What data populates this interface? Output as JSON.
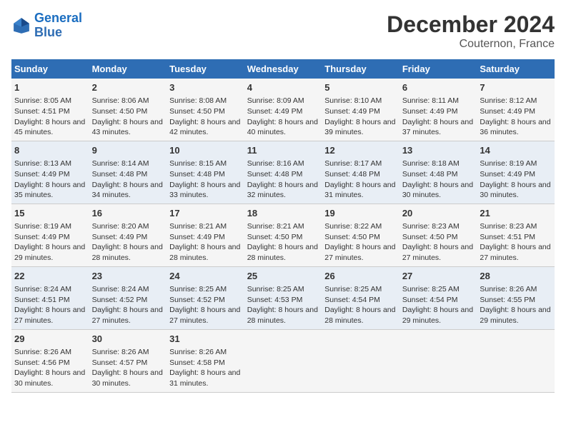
{
  "logo": {
    "line1": "General",
    "line2": "Blue"
  },
  "title": "December 2024",
  "subtitle": "Couternon, France",
  "days_header": [
    "Sunday",
    "Monday",
    "Tuesday",
    "Wednesday",
    "Thursday",
    "Friday",
    "Saturday"
  ],
  "weeks": [
    [
      {
        "day": "1",
        "sunrise": "Sunrise: 8:05 AM",
        "sunset": "Sunset: 4:51 PM",
        "daylight": "Daylight: 8 hours and 45 minutes."
      },
      {
        "day": "2",
        "sunrise": "Sunrise: 8:06 AM",
        "sunset": "Sunset: 4:50 PM",
        "daylight": "Daylight: 8 hours and 43 minutes."
      },
      {
        "day": "3",
        "sunrise": "Sunrise: 8:08 AM",
        "sunset": "Sunset: 4:50 PM",
        "daylight": "Daylight: 8 hours and 42 minutes."
      },
      {
        "day": "4",
        "sunrise": "Sunrise: 8:09 AM",
        "sunset": "Sunset: 4:49 PM",
        "daylight": "Daylight: 8 hours and 40 minutes."
      },
      {
        "day": "5",
        "sunrise": "Sunrise: 8:10 AM",
        "sunset": "Sunset: 4:49 PM",
        "daylight": "Daylight: 8 hours and 39 minutes."
      },
      {
        "day": "6",
        "sunrise": "Sunrise: 8:11 AM",
        "sunset": "Sunset: 4:49 PM",
        "daylight": "Daylight: 8 hours and 37 minutes."
      },
      {
        "day": "7",
        "sunrise": "Sunrise: 8:12 AM",
        "sunset": "Sunset: 4:49 PM",
        "daylight": "Daylight: 8 hours and 36 minutes."
      }
    ],
    [
      {
        "day": "8",
        "sunrise": "Sunrise: 8:13 AM",
        "sunset": "Sunset: 4:49 PM",
        "daylight": "Daylight: 8 hours and 35 minutes."
      },
      {
        "day": "9",
        "sunrise": "Sunrise: 8:14 AM",
        "sunset": "Sunset: 4:48 PM",
        "daylight": "Daylight: 8 hours and 34 minutes."
      },
      {
        "day": "10",
        "sunrise": "Sunrise: 8:15 AM",
        "sunset": "Sunset: 4:48 PM",
        "daylight": "Daylight: 8 hours and 33 minutes."
      },
      {
        "day": "11",
        "sunrise": "Sunrise: 8:16 AM",
        "sunset": "Sunset: 4:48 PM",
        "daylight": "Daylight: 8 hours and 32 minutes."
      },
      {
        "day": "12",
        "sunrise": "Sunrise: 8:17 AM",
        "sunset": "Sunset: 4:48 PM",
        "daylight": "Daylight: 8 hours and 31 minutes."
      },
      {
        "day": "13",
        "sunrise": "Sunrise: 8:18 AM",
        "sunset": "Sunset: 4:48 PM",
        "daylight": "Daylight: 8 hours and 30 minutes."
      },
      {
        "day": "14",
        "sunrise": "Sunrise: 8:19 AM",
        "sunset": "Sunset: 4:49 PM",
        "daylight": "Daylight: 8 hours and 30 minutes."
      }
    ],
    [
      {
        "day": "15",
        "sunrise": "Sunrise: 8:19 AM",
        "sunset": "Sunset: 4:49 PM",
        "daylight": "Daylight: 8 hours and 29 minutes."
      },
      {
        "day": "16",
        "sunrise": "Sunrise: 8:20 AM",
        "sunset": "Sunset: 4:49 PM",
        "daylight": "Daylight: 8 hours and 28 minutes."
      },
      {
        "day": "17",
        "sunrise": "Sunrise: 8:21 AM",
        "sunset": "Sunset: 4:49 PM",
        "daylight": "Daylight: 8 hours and 28 minutes."
      },
      {
        "day": "18",
        "sunrise": "Sunrise: 8:21 AM",
        "sunset": "Sunset: 4:50 PM",
        "daylight": "Daylight: 8 hours and 28 minutes."
      },
      {
        "day": "19",
        "sunrise": "Sunrise: 8:22 AM",
        "sunset": "Sunset: 4:50 PM",
        "daylight": "Daylight: 8 hours and 27 minutes."
      },
      {
        "day": "20",
        "sunrise": "Sunrise: 8:23 AM",
        "sunset": "Sunset: 4:50 PM",
        "daylight": "Daylight: 8 hours and 27 minutes."
      },
      {
        "day": "21",
        "sunrise": "Sunrise: 8:23 AM",
        "sunset": "Sunset: 4:51 PM",
        "daylight": "Daylight: 8 hours and 27 minutes."
      }
    ],
    [
      {
        "day": "22",
        "sunrise": "Sunrise: 8:24 AM",
        "sunset": "Sunset: 4:51 PM",
        "daylight": "Daylight: 8 hours and 27 minutes."
      },
      {
        "day": "23",
        "sunrise": "Sunrise: 8:24 AM",
        "sunset": "Sunset: 4:52 PM",
        "daylight": "Daylight: 8 hours and 27 minutes."
      },
      {
        "day": "24",
        "sunrise": "Sunrise: 8:25 AM",
        "sunset": "Sunset: 4:52 PM",
        "daylight": "Daylight: 8 hours and 27 minutes."
      },
      {
        "day": "25",
        "sunrise": "Sunrise: 8:25 AM",
        "sunset": "Sunset: 4:53 PM",
        "daylight": "Daylight: 8 hours and 28 minutes."
      },
      {
        "day": "26",
        "sunrise": "Sunrise: 8:25 AM",
        "sunset": "Sunset: 4:54 PM",
        "daylight": "Daylight: 8 hours and 28 minutes."
      },
      {
        "day": "27",
        "sunrise": "Sunrise: 8:25 AM",
        "sunset": "Sunset: 4:54 PM",
        "daylight": "Daylight: 8 hours and 29 minutes."
      },
      {
        "day": "28",
        "sunrise": "Sunrise: 8:26 AM",
        "sunset": "Sunset: 4:55 PM",
        "daylight": "Daylight: 8 hours and 29 minutes."
      }
    ],
    [
      {
        "day": "29",
        "sunrise": "Sunrise: 8:26 AM",
        "sunset": "Sunset: 4:56 PM",
        "daylight": "Daylight: 8 hours and 30 minutes."
      },
      {
        "day": "30",
        "sunrise": "Sunrise: 8:26 AM",
        "sunset": "Sunset: 4:57 PM",
        "daylight": "Daylight: 8 hours and 30 minutes."
      },
      {
        "day": "31",
        "sunrise": "Sunrise: 8:26 AM",
        "sunset": "Sunset: 4:58 PM",
        "daylight": "Daylight: 8 hours and 31 minutes."
      },
      null,
      null,
      null,
      null
    ]
  ]
}
